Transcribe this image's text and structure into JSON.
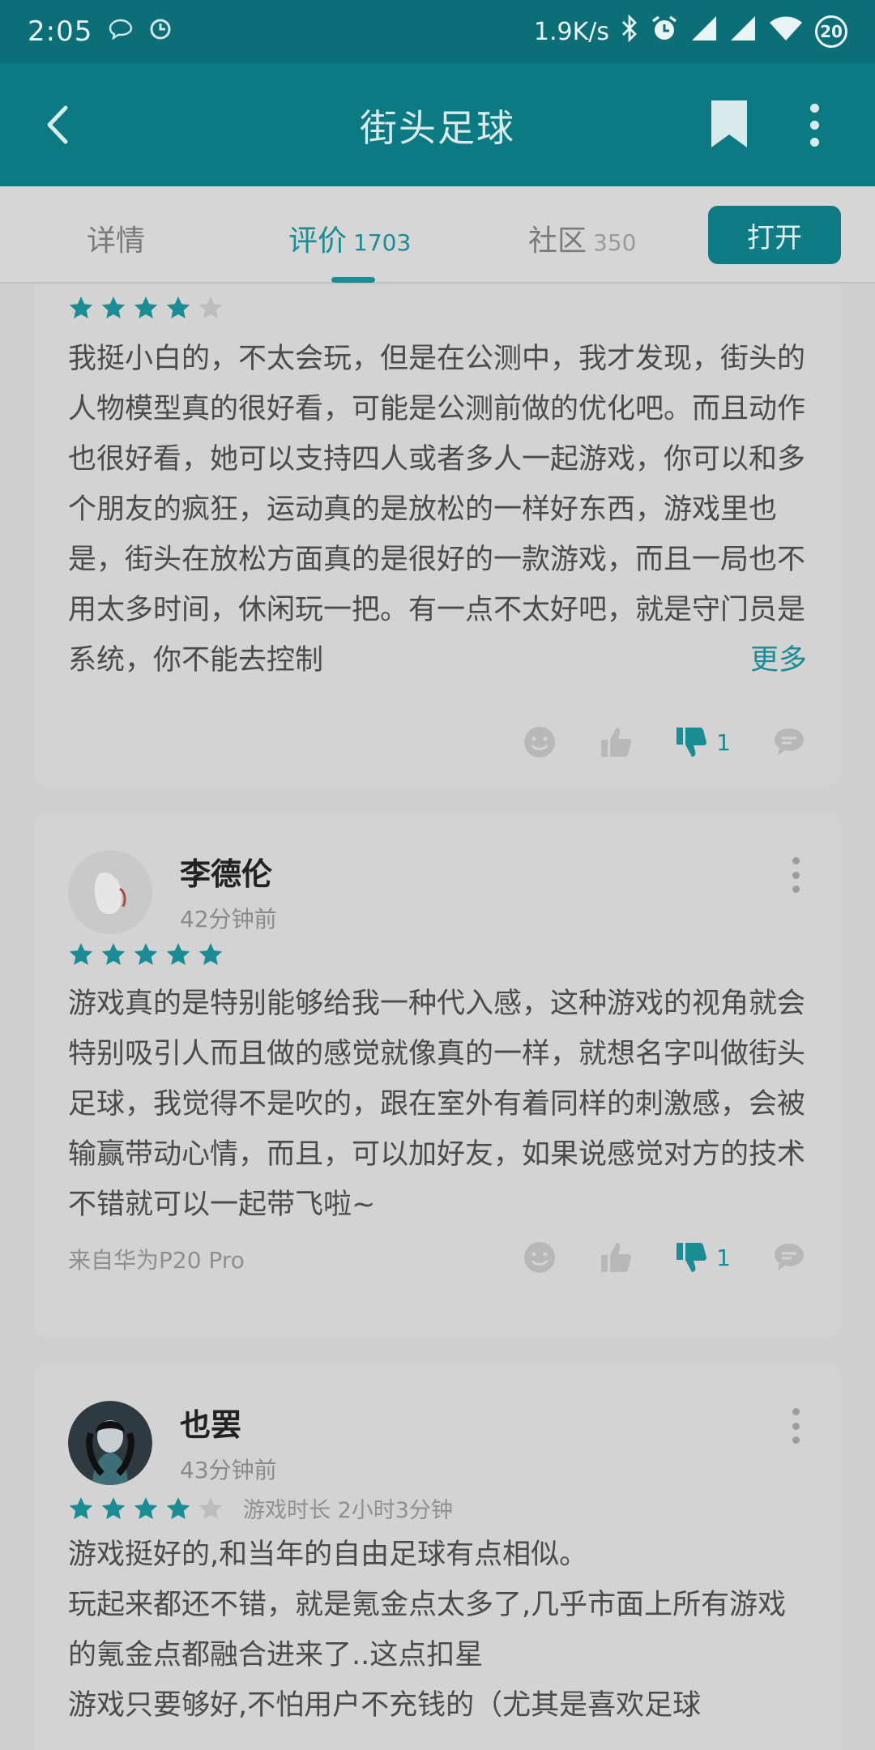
{
  "status_bar": {
    "time": "2:05",
    "speed": "1.9K/s",
    "battery": "20",
    "icons": [
      "chat-bubble-icon",
      "clock-icon",
      "bluetooth-icon",
      "alarm-icon",
      "signal-icon",
      "signal-icon",
      "wifi-icon",
      "battery-icon"
    ]
  },
  "app_bar": {
    "title": "街头足球",
    "icons": [
      "back-arrow-icon",
      "bookmark-icon",
      "more-vert-icon"
    ]
  },
  "tabs": [
    {
      "label": "详情",
      "count": ""
    },
    {
      "label": "评价",
      "count": "1703"
    },
    {
      "label": "社区",
      "count": "350"
    }
  ],
  "open_button": "打开",
  "colors": {
    "accent": "#1a8c94",
    "appbar": "#0c7a82",
    "overlay_bg": "#cfcfcf"
  },
  "reviews": [
    {
      "stars": 4,
      "text": "我挺小白的，不太会玩，但是在公测中，我才发现，街头的人物模型真的很好看，可能是公测前做的优化吧。而且动作也很好看，她可以支持四人或者多人一起游戏，你可以和多个朋友的疯狂，运动真的是放松的一样好东西，游戏里也是，街头在放松方面真的是很好的一款游戏，而且一局也不用太多时间，休闲玩一把。有一点不太好吧，就是守门员是系统，你不能去控制",
      "more_label": "更多",
      "dislikes": "1"
    },
    {
      "name": "李德伦",
      "time": "42分钟前",
      "stars": 5,
      "text": "游戏真的是特别能够给我一种代入感，这种游戏的视角就会特别吸引人而且做的感觉就像真的一样，就想名字叫做街头足球，我觉得不是吹的，跟在室外有着同样的刺激感，会被输赢带动心情，而且，可以加好友，如果说感觉对方的技术不错就可以一起带飞啦~",
      "device": "来自华为P20 Pro",
      "dislikes": "1"
    },
    {
      "name": "也罢",
      "time": "43分钟前",
      "stars": 4,
      "playtime": "游戏时长 2小时3分钟",
      "lines": [
        "游戏挺好的,和当年的自由足球有点相似。",
        "玩起来都还不错，就是氪金点太多了,几乎市面上所有游戏的氪金点都融合进来了..这点扣星",
        "游戏只要够好,不怕用户不充钱的（尤其是喜欢足球"
      ]
    }
  ]
}
